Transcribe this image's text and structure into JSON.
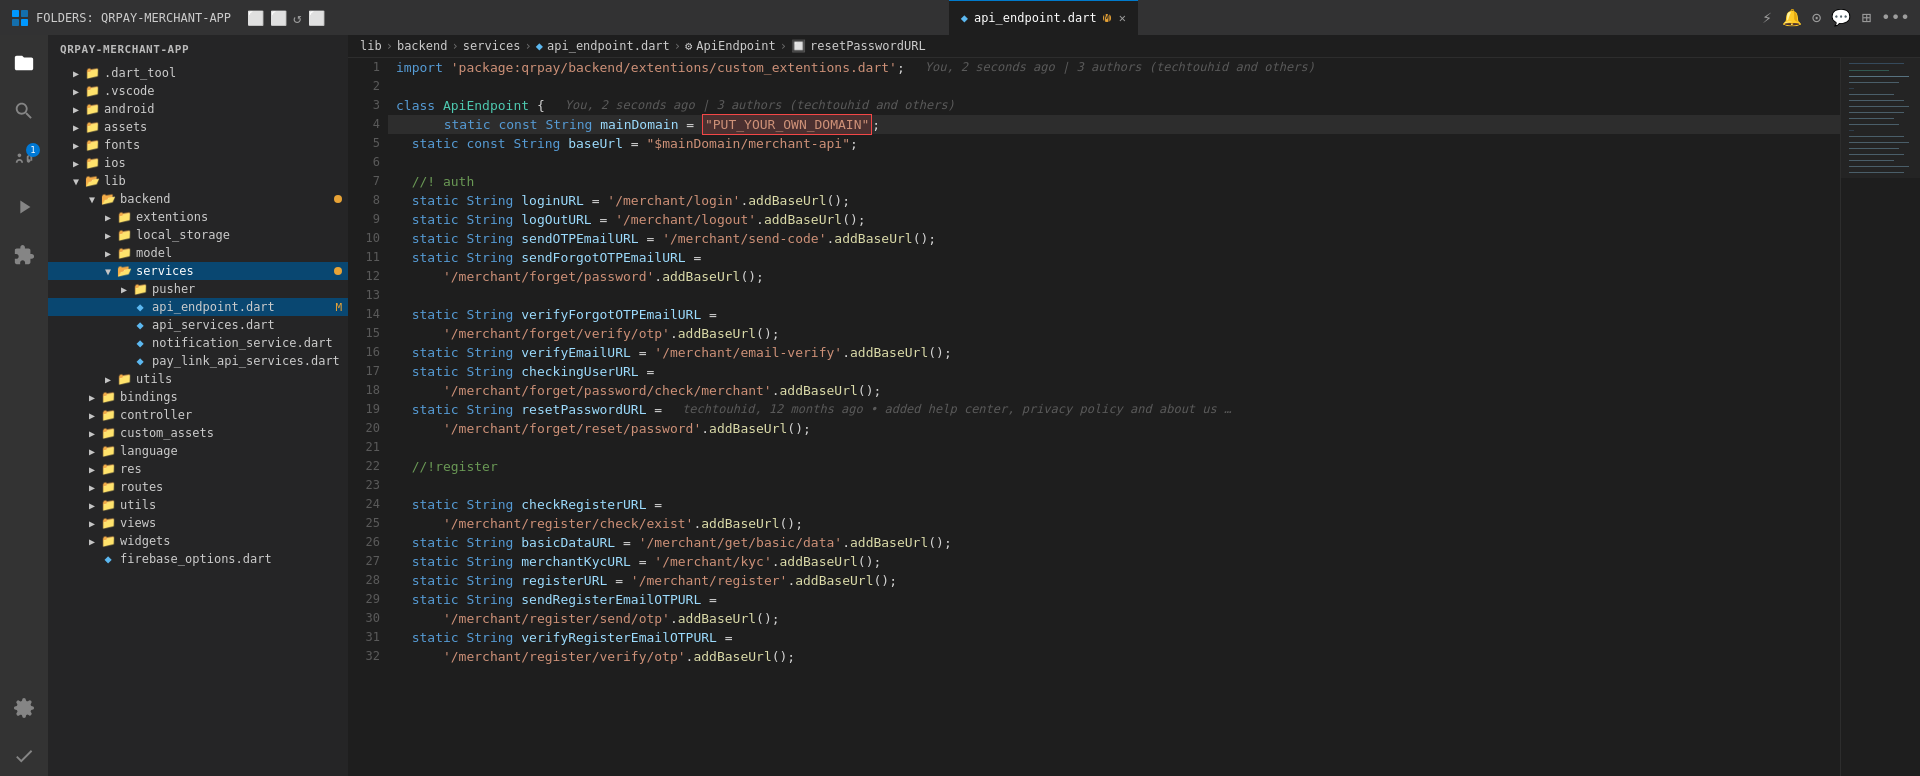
{
  "titleBar": {
    "folderLabel": "FOLDERS: QRPAY-MERCHANT-APP",
    "tabFile": "api_endpoint.dart",
    "tabModified": "M",
    "icons": {
      "newFile": "⬜",
      "newFolder": "⬜",
      "refresh": "↺",
      "collapseAll": "⬜"
    }
  },
  "breadcrumb": {
    "parts": [
      "lib",
      "backend",
      "services",
      "api_endpoint.dart",
      "ApiEndpoint",
      "resetPasswordURL"
    ]
  },
  "blame1": {
    "text": "You, 2 seconds ago | 3 authors (techtouhid and others)"
  },
  "blame2": {
    "text": "You, 2 seconds ago | 3 authors (techtouhid and others)"
  },
  "sidebar": {
    "header": "FOLDERS: QRPAY-MERCHANT-APP",
    "items": [
      {
        "id": "dart_tool",
        "label": ".dart_tool",
        "type": "folder",
        "indent": 1,
        "collapsed": true
      },
      {
        "id": "vscode",
        "label": ".vscode",
        "type": "folder",
        "indent": 1,
        "collapsed": true
      },
      {
        "id": "android",
        "label": "android",
        "type": "folder",
        "indent": 1,
        "collapsed": true
      },
      {
        "id": "assets",
        "label": "assets",
        "type": "folder",
        "indent": 1,
        "collapsed": true
      },
      {
        "id": "fonts",
        "label": "fonts",
        "type": "folder",
        "indent": 1,
        "collapsed": true
      },
      {
        "id": "ios",
        "label": "ios",
        "type": "folder",
        "indent": 1,
        "collapsed": true
      },
      {
        "id": "lib",
        "label": "lib",
        "type": "folder",
        "indent": 1,
        "expanded": true
      },
      {
        "id": "backend",
        "label": "backend",
        "type": "folder",
        "indent": 2,
        "expanded": true,
        "dot": "orange"
      },
      {
        "id": "extentions",
        "label": "extentions",
        "type": "folder",
        "indent": 3,
        "collapsed": true
      },
      {
        "id": "local_storage",
        "label": "local_storage",
        "type": "folder",
        "indent": 3,
        "collapsed": true
      },
      {
        "id": "model",
        "label": "model",
        "type": "folder",
        "indent": 3,
        "collapsed": true
      },
      {
        "id": "services",
        "label": "services",
        "type": "folder",
        "indent": 3,
        "expanded": true,
        "dot": "orange"
      },
      {
        "id": "pusher",
        "label": "pusher",
        "type": "folder",
        "indent": 4,
        "collapsed": true
      },
      {
        "id": "api_endpoint.dart",
        "label": "api_endpoint.dart",
        "type": "dart",
        "indent": 4,
        "selected": true,
        "modified": "M"
      },
      {
        "id": "api_services.dart",
        "label": "api_services.dart",
        "type": "dart",
        "indent": 4
      },
      {
        "id": "notification_service.dart",
        "label": "notification_service.dart",
        "type": "dart",
        "indent": 4
      },
      {
        "id": "pay_link_api_services.dart",
        "label": "pay_link_api_services.dart",
        "type": "dart",
        "indent": 4
      },
      {
        "id": "utils_inner",
        "label": "utils",
        "type": "folder",
        "indent": 3,
        "collapsed": true
      },
      {
        "id": "bindings",
        "label": "bindings",
        "type": "folder",
        "indent": 2,
        "collapsed": true
      },
      {
        "id": "controller",
        "label": "controller",
        "type": "folder",
        "indent": 2,
        "collapsed": true
      },
      {
        "id": "custom_assets",
        "label": "custom_assets",
        "type": "folder",
        "indent": 2,
        "collapsed": true
      },
      {
        "id": "language",
        "label": "language",
        "type": "folder",
        "indent": 2,
        "collapsed": true
      },
      {
        "id": "res",
        "label": "res",
        "type": "folder",
        "indent": 2,
        "collapsed": true
      },
      {
        "id": "routes",
        "label": "routes",
        "type": "folder",
        "indent": 2,
        "collapsed": true
      },
      {
        "id": "utils",
        "label": "utils",
        "type": "folder",
        "indent": 2,
        "collapsed": true
      },
      {
        "id": "views",
        "label": "views",
        "type": "folder",
        "indent": 2,
        "collapsed": true
      },
      {
        "id": "widgets",
        "label": "widgets",
        "type": "folder",
        "indent": 2,
        "collapsed": true
      },
      {
        "id": "firebase_options.dart",
        "label": "firebase_options.dart",
        "type": "dart",
        "indent": 2
      }
    ]
  },
  "codeLines": [
    {
      "num": 1,
      "blame": "You, 2 seconds ago | 3 authors (techtouhid and others)",
      "tokens": [
        {
          "t": "import ",
          "c": "kw"
        },
        {
          "t": "'package:qrpay/backend/extentions/custom_extentions.dart'",
          "c": "str"
        },
        {
          "t": ";",
          "c": "punct"
        }
      ]
    },
    {
      "num": 2,
      "tokens": []
    },
    {
      "num": 3,
      "blame": "You, 2 seconds ago | 3 authors (techtouhid and others)",
      "tokens": [
        {
          "t": "class ",
          "c": "kw"
        },
        {
          "t": "ApiEndpoint ",
          "c": "cls"
        },
        {
          "t": "{",
          "c": "punct"
        }
      ]
    },
    {
      "num": 4,
      "highlighted": true,
      "tokens": [
        {
          "t": "  static ",
          "c": "kw"
        },
        {
          "t": "const ",
          "c": "kw"
        },
        {
          "t": "String ",
          "c": "kw"
        },
        {
          "t": "mainDomain ",
          "c": "var"
        },
        {
          "t": "= ",
          "c": "op"
        },
        {
          "t": "\"PUT_YOUR_OWN_DOMAIN\"",
          "c": "str highlight-box"
        },
        {
          "t": ";",
          "c": "punct"
        }
      ]
    },
    {
      "num": 5,
      "tokens": [
        {
          "t": "  static ",
          "c": "kw"
        },
        {
          "t": "const ",
          "c": "kw"
        },
        {
          "t": "String ",
          "c": "kw"
        },
        {
          "t": "baseUrl ",
          "c": "var"
        },
        {
          "t": "= ",
          "c": "op"
        },
        {
          "t": "\"$mainDomain/merchant-api\"",
          "c": "str"
        },
        {
          "t": ";",
          "c": "punct"
        }
      ]
    },
    {
      "num": 6,
      "tokens": []
    },
    {
      "num": 7,
      "tokens": [
        {
          "t": "  //! auth",
          "c": "cmt"
        }
      ]
    },
    {
      "num": 8,
      "tokens": [
        {
          "t": "  static ",
          "c": "kw"
        },
        {
          "t": "String ",
          "c": "kw"
        },
        {
          "t": "loginURL ",
          "c": "var"
        },
        {
          "t": "= ",
          "c": "op"
        },
        {
          "t": "'/merchant/login'",
          "c": "str"
        },
        {
          "t": ".",
          "c": "punct"
        },
        {
          "t": "addBaseUrl",
          "c": "fn"
        },
        {
          "t": "();",
          "c": "punct"
        }
      ]
    },
    {
      "num": 9,
      "tokens": [
        {
          "t": "  static ",
          "c": "kw"
        },
        {
          "t": "String ",
          "c": "kw"
        },
        {
          "t": "logOutURL ",
          "c": "var"
        },
        {
          "t": "= ",
          "c": "op"
        },
        {
          "t": "'/merchant/logout'",
          "c": "str"
        },
        {
          "t": ".",
          "c": "punct"
        },
        {
          "t": "addBaseUrl",
          "c": "fn"
        },
        {
          "t": "();",
          "c": "punct"
        }
      ]
    },
    {
      "num": 10,
      "tokens": [
        {
          "t": "  static ",
          "c": "kw"
        },
        {
          "t": "String ",
          "c": "kw"
        },
        {
          "t": "sendOTPEmailURL ",
          "c": "var"
        },
        {
          "t": "= ",
          "c": "op"
        },
        {
          "t": "'/merchant/send-code'",
          "c": "str"
        },
        {
          "t": ".",
          "c": "punct"
        },
        {
          "t": "addBaseUrl",
          "c": "fn"
        },
        {
          "t": "();",
          "c": "punct"
        }
      ]
    },
    {
      "num": 11,
      "tokens": [
        {
          "t": "  static ",
          "c": "kw"
        },
        {
          "t": "String ",
          "c": "kw"
        },
        {
          "t": "sendForgotOTPEmailURL ",
          "c": "var"
        },
        {
          "t": "=",
          "c": "op"
        }
      ]
    },
    {
      "num": 12,
      "tokens": [
        {
          "t": "      ",
          "c": ""
        },
        {
          "t": "'/merchant/forget/password'",
          "c": "str"
        },
        {
          "t": ".",
          "c": "punct"
        },
        {
          "t": "addBaseUrl",
          "c": "fn"
        },
        {
          "t": "();",
          "c": "punct"
        }
      ]
    },
    {
      "num": 13,
      "tokens": []
    },
    {
      "num": 14,
      "tokens": [
        {
          "t": "  static ",
          "c": "kw"
        },
        {
          "t": "String ",
          "c": "kw"
        },
        {
          "t": "verifyForgotOTPEmailURL ",
          "c": "var"
        },
        {
          "t": "=",
          "c": "op"
        }
      ]
    },
    {
      "num": 15,
      "tokens": [
        {
          "t": "      ",
          "c": ""
        },
        {
          "t": "'/merchant/forget/verify/otp'",
          "c": "str"
        },
        {
          "t": ".",
          "c": "punct"
        },
        {
          "t": "addBaseUrl",
          "c": "fn"
        },
        {
          "t": "();",
          "c": "punct"
        }
      ]
    },
    {
      "num": 16,
      "tokens": [
        {
          "t": "  static ",
          "c": "kw"
        },
        {
          "t": "String ",
          "c": "kw"
        },
        {
          "t": "verifyEmailURL ",
          "c": "var"
        },
        {
          "t": "= ",
          "c": "op"
        },
        {
          "t": "'/merchant/email-verify'",
          "c": "str"
        },
        {
          "t": ".",
          "c": "punct"
        },
        {
          "t": "addBaseUrl",
          "c": "fn"
        },
        {
          "t": "();",
          "c": "punct"
        }
      ]
    },
    {
      "num": 17,
      "tokens": [
        {
          "t": "  static ",
          "c": "kw"
        },
        {
          "t": "String ",
          "c": "kw"
        },
        {
          "t": "checkingUserURL ",
          "c": "var"
        },
        {
          "t": "=",
          "c": "op"
        }
      ]
    },
    {
      "num": 18,
      "tokens": [
        {
          "t": "      ",
          "c": ""
        },
        {
          "t": "'/merchant/forget/password/check/merchant'",
          "c": "str"
        },
        {
          "t": ".",
          "c": "punct"
        },
        {
          "t": "addBaseUrl",
          "c": "fn"
        },
        {
          "t": "();",
          "c": "punct"
        }
      ]
    },
    {
      "num": 19,
      "tokens": [
        {
          "t": "  static ",
          "c": "kw"
        },
        {
          "t": "String ",
          "c": "kw"
        },
        {
          "t": "resetPasswordURL ",
          "c": "var"
        },
        {
          "t": "=",
          "c": "op"
        }
      ],
      "blameRight": "techtouhid, 12 months ago • added help center, privacy policy and about us …"
    },
    {
      "num": 20,
      "tokens": [
        {
          "t": "      ",
          "c": ""
        },
        {
          "t": "'/merchant/forget/reset/password'",
          "c": "str"
        },
        {
          "t": ".",
          "c": "punct"
        },
        {
          "t": "addBaseUrl",
          "c": "fn"
        },
        {
          "t": "();",
          "c": "punct"
        }
      ]
    },
    {
      "num": 21,
      "tokens": []
    },
    {
      "num": 22,
      "tokens": [
        {
          "t": "  //!register",
          "c": "cmt"
        }
      ]
    },
    {
      "num": 23,
      "tokens": []
    },
    {
      "num": 24,
      "tokens": [
        {
          "t": "  static ",
          "c": "kw"
        },
        {
          "t": "String ",
          "c": "kw"
        },
        {
          "t": "checkRegisterURL ",
          "c": "var"
        },
        {
          "t": "=",
          "c": "op"
        }
      ]
    },
    {
      "num": 25,
      "tokens": [
        {
          "t": "      ",
          "c": ""
        },
        {
          "t": "'/merchant/register/check/exist'",
          "c": "str"
        },
        {
          "t": ".",
          "c": "punct"
        },
        {
          "t": "addBaseUrl",
          "c": "fn"
        },
        {
          "t": "();",
          "c": "punct"
        }
      ]
    },
    {
      "num": 26,
      "tokens": [
        {
          "t": "  static ",
          "c": "kw"
        },
        {
          "t": "String ",
          "c": "kw"
        },
        {
          "t": "basicDataURL ",
          "c": "var"
        },
        {
          "t": "= ",
          "c": "op"
        },
        {
          "t": "'/merchant/get/basic/data'",
          "c": "str"
        },
        {
          "t": ".",
          "c": "punct"
        },
        {
          "t": "addBaseUrl",
          "c": "fn"
        },
        {
          "t": "();",
          "c": "punct"
        }
      ]
    },
    {
      "num": 27,
      "tokens": [
        {
          "t": "  static ",
          "c": "kw"
        },
        {
          "t": "String ",
          "c": "kw"
        },
        {
          "t": "merchantKycURL ",
          "c": "var"
        },
        {
          "t": "= ",
          "c": "op"
        },
        {
          "t": "'/merchant/kyc'",
          "c": "str"
        },
        {
          "t": ".",
          "c": "punct"
        },
        {
          "t": "addBaseUrl",
          "c": "fn"
        },
        {
          "t": "();",
          "c": "punct"
        }
      ]
    },
    {
      "num": 28,
      "tokens": [
        {
          "t": "  static ",
          "c": "kw"
        },
        {
          "t": "String ",
          "c": "kw"
        },
        {
          "t": "registerURL ",
          "c": "var"
        },
        {
          "t": "= ",
          "c": "op"
        },
        {
          "t": "'/merchant/register'",
          "c": "str"
        },
        {
          "t": ".",
          "c": "punct"
        },
        {
          "t": "addBaseUrl",
          "c": "fn"
        },
        {
          "t": "();",
          "c": "punct"
        }
      ]
    },
    {
      "num": 29,
      "tokens": [
        {
          "t": "  static ",
          "c": "kw"
        },
        {
          "t": "String ",
          "c": "kw"
        },
        {
          "t": "sendRegisterEmailOTPURL ",
          "c": "var"
        },
        {
          "t": "=",
          "c": "op"
        }
      ]
    },
    {
      "num": 30,
      "tokens": [
        {
          "t": "      ",
          "c": ""
        },
        {
          "t": "'/merchant/register/send/otp'",
          "c": "str"
        },
        {
          "t": ".",
          "c": "punct"
        },
        {
          "t": "addBaseUrl",
          "c": "fn"
        },
        {
          "t": "();",
          "c": "punct"
        }
      ]
    },
    {
      "num": 31,
      "tokens": [
        {
          "t": "  static ",
          "c": "kw"
        },
        {
          "t": "String ",
          "c": "kw"
        },
        {
          "t": "verifyRegisterEmailOTPURL ",
          "c": "var"
        },
        {
          "t": "=",
          "c": "op"
        }
      ]
    },
    {
      "num": 32,
      "tokens": [
        {
          "t": "      ",
          "c": ""
        },
        {
          "t": "'/merchant/register/verify/otp'",
          "c": "str"
        },
        {
          "t": ".",
          "c": "punct"
        },
        {
          "t": "addBaseUrl",
          "c": "fn"
        },
        {
          "t": "();",
          "c": "punct"
        }
      ]
    }
  ],
  "activityBar": {
    "items": [
      {
        "id": "explorer",
        "icon": "files",
        "active": true
      },
      {
        "id": "search",
        "icon": "search",
        "active": false
      },
      {
        "id": "source-control",
        "icon": "source-control",
        "active": false,
        "badge": "1"
      },
      {
        "id": "run",
        "icon": "run",
        "active": false
      },
      {
        "id": "extensions",
        "icon": "extensions",
        "active": false
      },
      {
        "id": "git-lens",
        "icon": "gitlens",
        "active": false
      },
      {
        "id": "check",
        "icon": "check",
        "active": false
      },
      {
        "id": "remote",
        "icon": "remote",
        "active": false
      }
    ]
  }
}
